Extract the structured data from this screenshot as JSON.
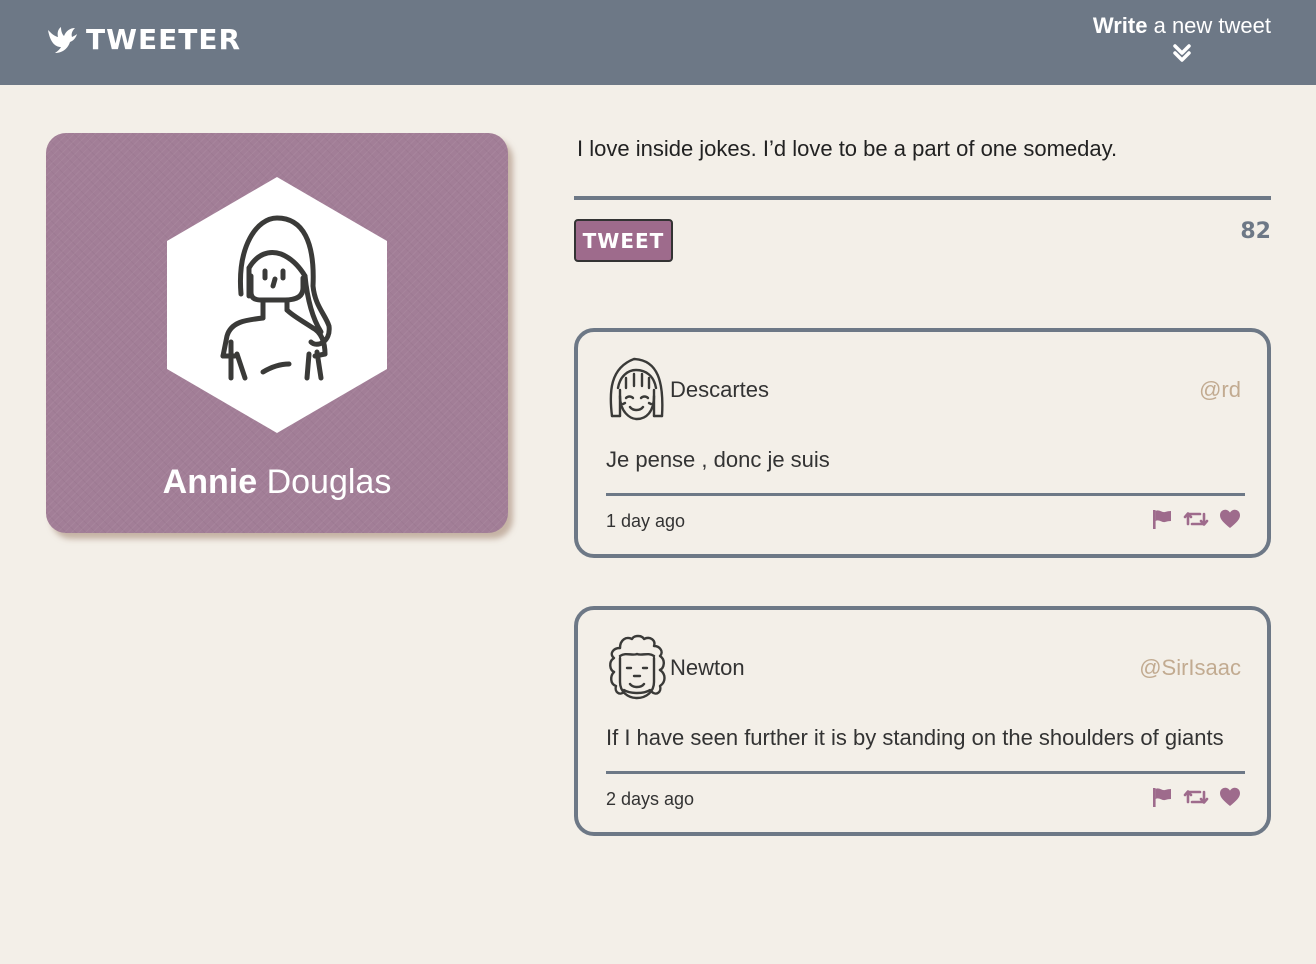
{
  "nav": {
    "brand": "TWEETER",
    "brand_icon": "bird-icon",
    "compose_strong": "Write",
    "compose_rest": " a new tweet",
    "compose_icon": "double-chevron-down-icon"
  },
  "profile": {
    "first_name": "Annie",
    "last_name": " Douglas",
    "avatar_icon": "woman-avatar-icon",
    "card_color": "#a27e97"
  },
  "compose": {
    "text": "I love inside jokes. I’d love to be a part of one someday.",
    "button_label": "TWEET",
    "counter": "82",
    "button_color": "#9e6b8c"
  },
  "tweets": [
    {
      "author": "Descartes",
      "handle": "@rd",
      "content": "Je pense , donc je suis",
      "time": "1 day ago",
      "avatar_icon": "descartes-avatar-icon"
    },
    {
      "author": "Newton",
      "handle": "@SirIsaac",
      "content": "If I have seen further it is by standing on the shoulders of giants",
      "time": "2 days ago",
      "avatar_icon": "newton-avatar-icon"
    }
  ],
  "actions": [
    "flag-icon",
    "retweet-icon",
    "heart-icon"
  ],
  "colors": {
    "nav": "#6d7886",
    "background": "#f3efe8",
    "accent": "#9e6b8c",
    "handle": "#c2ab91"
  }
}
